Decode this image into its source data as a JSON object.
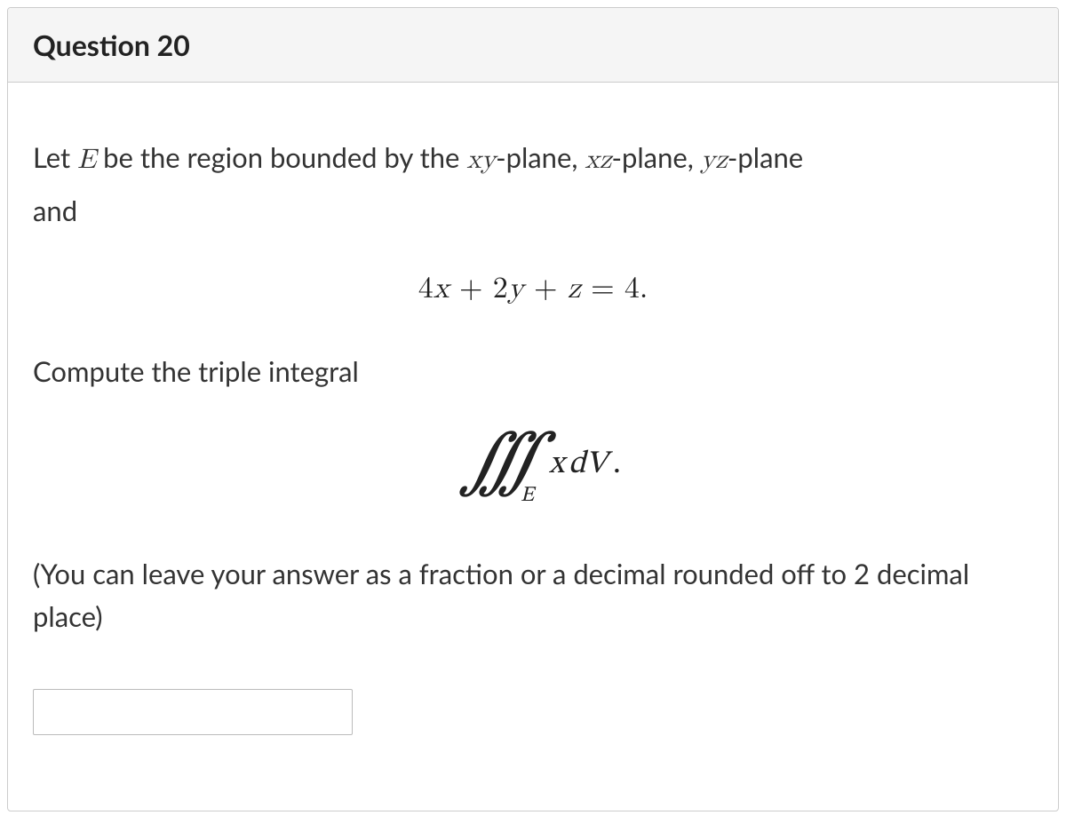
{
  "question": {
    "title": "Question 20",
    "intro_prefix": "Let ",
    "intro_E": "E",
    "intro_mid1": " be the region bounded by the ",
    "plane1_var": "xy",
    "plane_suffix": "-plane, ",
    "plane2_var": "xz",
    "plane3_var": "yz",
    "plane3_suffix": "-plane",
    "intro_and": "and",
    "equation": "4x + 2y + z = 4.",
    "compute_text": "Compute the triple integral",
    "integral_expr": "∭_E x dV.",
    "note_text": "(You can leave your answer as a fraction or a decimal rounded off to 2 decimal place)",
    "answer_value": ""
  }
}
